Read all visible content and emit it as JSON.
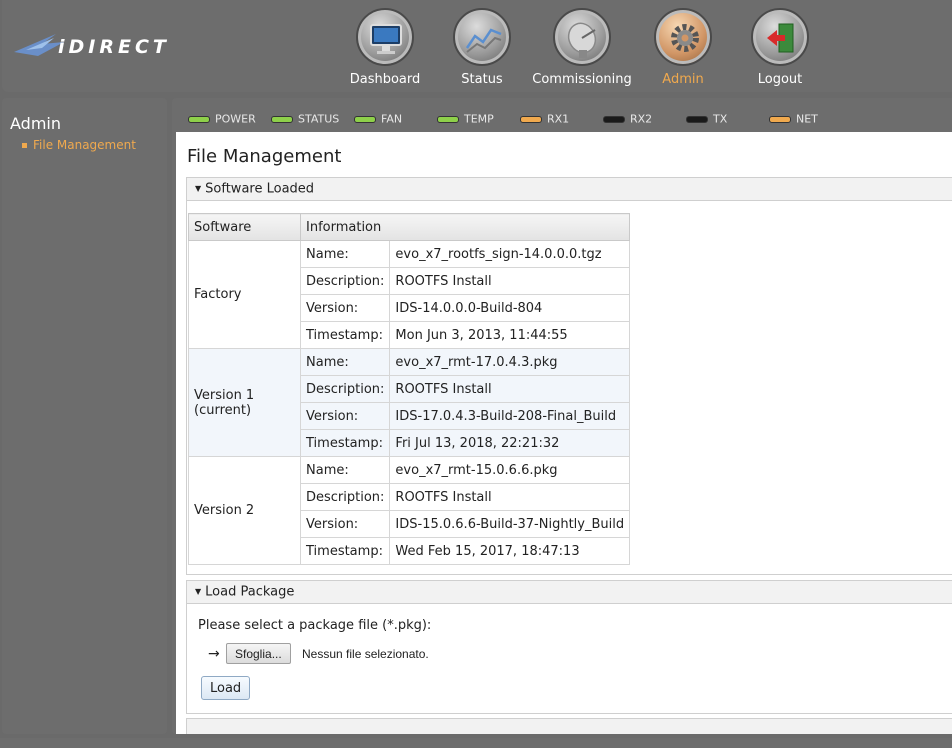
{
  "logo": {
    "text": "iDIRECT"
  },
  "nav": [
    {
      "label": "Dashboard",
      "icon": "dashboard-monitor-icon",
      "active": false
    },
    {
      "label": "Status",
      "icon": "status-graph-icon",
      "active": false
    },
    {
      "label": "Commissioning",
      "icon": "satellite-dish-icon",
      "active": false
    },
    {
      "label": "Admin",
      "icon": "gear-icon",
      "active": true
    },
    {
      "label": "Logout",
      "icon": "logout-door-icon",
      "active": false
    }
  ],
  "sidebar": {
    "title": "Admin",
    "link": "File Management"
  },
  "leds": [
    {
      "label": "POWER",
      "color": "#8ed04a"
    },
    {
      "label": "STATUS",
      "color": "#8ed04a"
    },
    {
      "label": "FAN",
      "color": "#8ed04a"
    },
    {
      "label": "TEMP",
      "color": "#8ed04a"
    },
    {
      "label": "RX1",
      "color": "#f0a94e"
    },
    {
      "label": "RX2",
      "color": "#1a1a1a"
    },
    {
      "label": "TX",
      "color": "#1a1a1a"
    },
    {
      "label": "NET",
      "color": "#f0a94e"
    }
  ],
  "page": {
    "title": "File Management"
  },
  "software_panel": {
    "title": "Software Loaded",
    "headers": [
      "Software",
      "Information"
    ],
    "groups": [
      {
        "name": "Factory",
        "rows": [
          {
            "key": "Name:",
            "value": "evo_x7_rootfs_sign-14.0.0.0.tgz"
          },
          {
            "key": "Description:",
            "value": "ROOTFS Install"
          },
          {
            "key": "Version:",
            "value": "IDS-14.0.0.0-Build-804"
          },
          {
            "key": "Timestamp:",
            "value": "Mon Jun 3, 2013, 11:44:55"
          }
        ]
      },
      {
        "name": "Version 1 (current)",
        "name_line1": "Version 1",
        "name_line2": "(current)",
        "rows": [
          {
            "key": "Name:",
            "value": "evo_x7_rmt-17.0.4.3.pkg"
          },
          {
            "key": "Description:",
            "value": "ROOTFS Install"
          },
          {
            "key": "Version:",
            "value": "IDS-17.0.4.3-Build-208-Final_Build"
          },
          {
            "key": "Timestamp:",
            "value": "Fri Jul 13, 2018, 22:21:32"
          }
        ]
      },
      {
        "name": "Version 2",
        "rows": [
          {
            "key": "Name:",
            "value": "evo_x7_rmt-15.0.6.6.pkg"
          },
          {
            "key": "Description:",
            "value": "ROOTFS Install"
          },
          {
            "key": "Version:",
            "value": "IDS-15.0.6.6-Build-37-Nightly_Build"
          },
          {
            "key": "Timestamp:",
            "value": "Wed Feb 15, 2017, 18:47:13"
          }
        ]
      }
    ]
  },
  "load_panel": {
    "title": "Load Package",
    "prompt": "Please select a package file (*.pkg):",
    "arrow": "→",
    "browse_label": "Sfoglia...",
    "file_status": "Nessun file selezionato.",
    "load_label": "Load"
  }
}
